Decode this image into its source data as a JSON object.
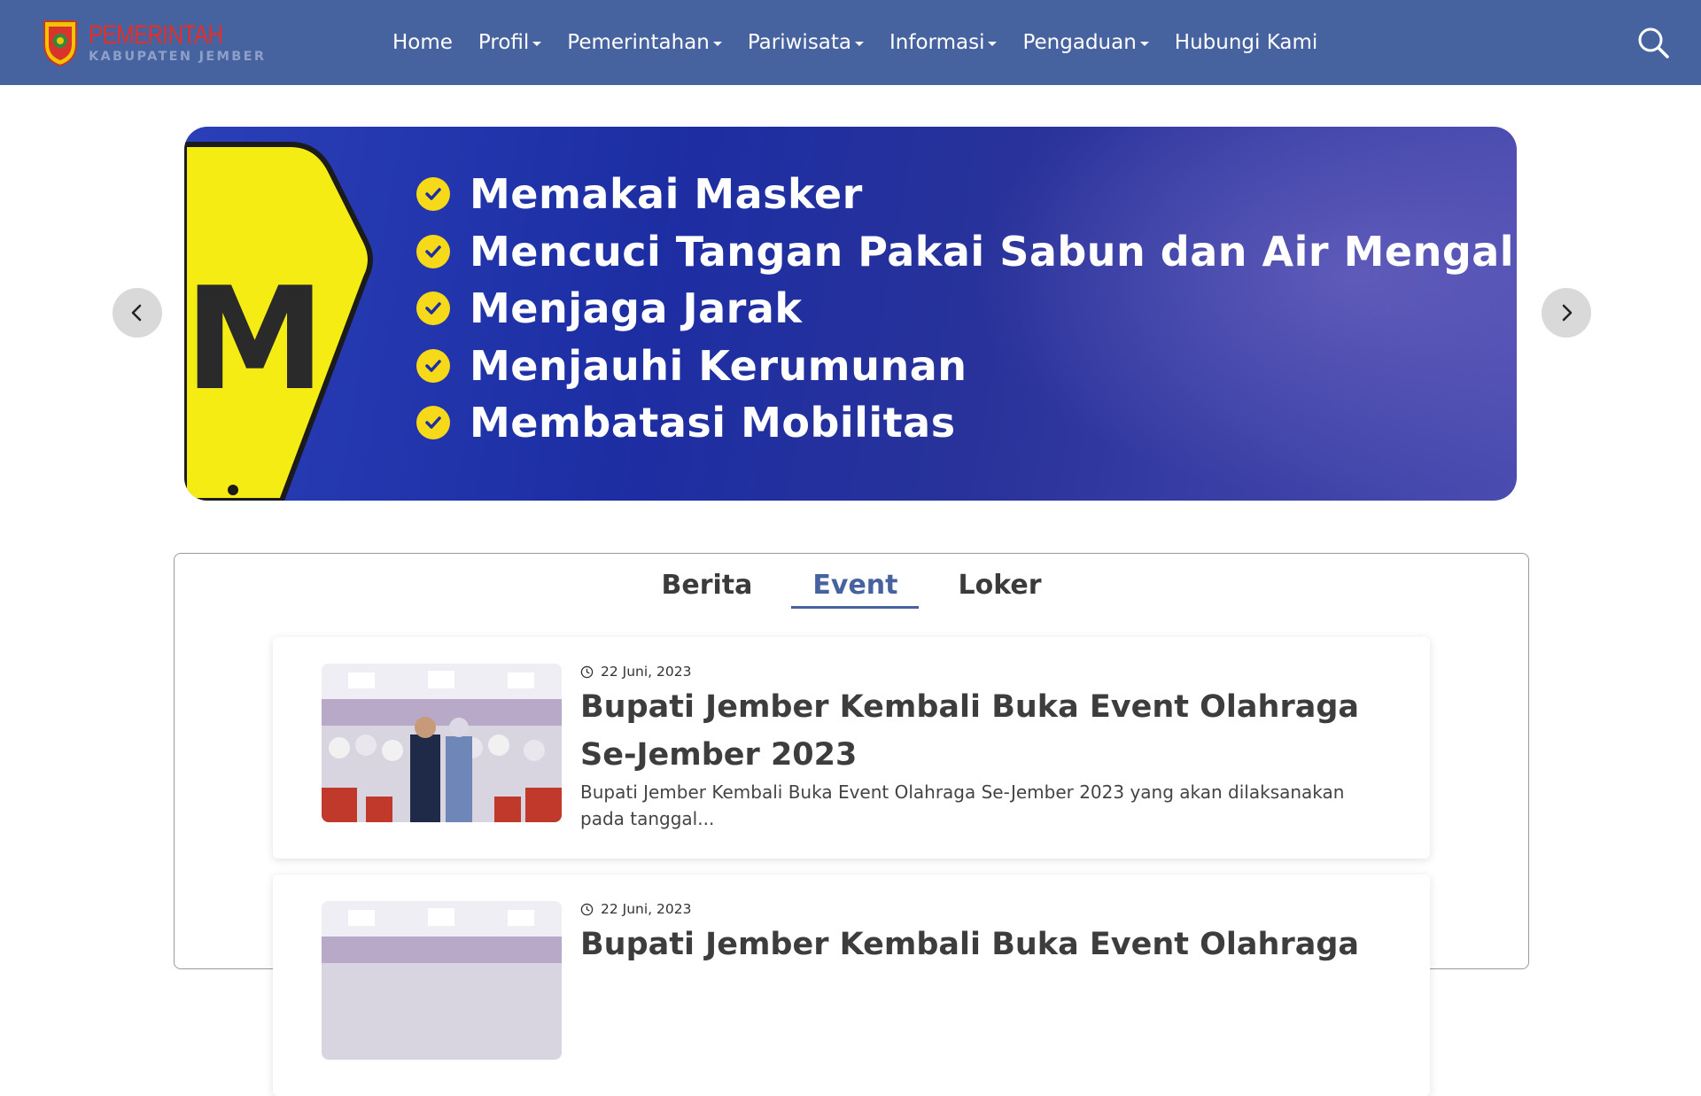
{
  "header": {
    "logo_title": "PEMERINTAH",
    "logo_subtitle": "KABUPATEN JEMBER",
    "nav": [
      {
        "label": "Home",
        "has_dropdown": false
      },
      {
        "label": "Profil",
        "has_dropdown": true
      },
      {
        "label": "Pemerintahan",
        "has_dropdown": true
      },
      {
        "label": "Pariwisata",
        "has_dropdown": true
      },
      {
        "label": "Informasi",
        "has_dropdown": true
      },
      {
        "label": "Pengaduan",
        "has_dropdown": true
      },
      {
        "label": "Hubungi Kami",
        "has_dropdown": false
      }
    ],
    "search_icon": "search-icon",
    "bg_color": "#46639f"
  },
  "carousel": {
    "items": [
      "Memakai Masker",
      "Mencuci Tangan Pakai Sabun dan Air Mengalir",
      "Menjaga Jarak",
      "Menjauhi Kerumunan",
      "Membatasi Mobilitas"
    ],
    "sign_letter": "M",
    "prev_icon": "chevron-left-icon",
    "next_icon": "chevron-right-icon",
    "accent_color": "#f6d919"
  },
  "tabs": {
    "items": [
      "Berita",
      "Event",
      "Loker"
    ],
    "active": "Event",
    "active_color": "#46639f"
  },
  "events": [
    {
      "date": "22 Juni, 2023",
      "title": "Bupati Jember Kembali Buka Event Olahraga Se-Jember 2023",
      "description": "Bupati Jember Kembali Buka Event Olahraga Se-Jember 2023 yang akan dilaksanakan pada tanggal..."
    },
    {
      "date": "22 Juni, 2023",
      "title": "Bupati Jember Kembali Buka Event Olahraga",
      "description": ""
    }
  ]
}
